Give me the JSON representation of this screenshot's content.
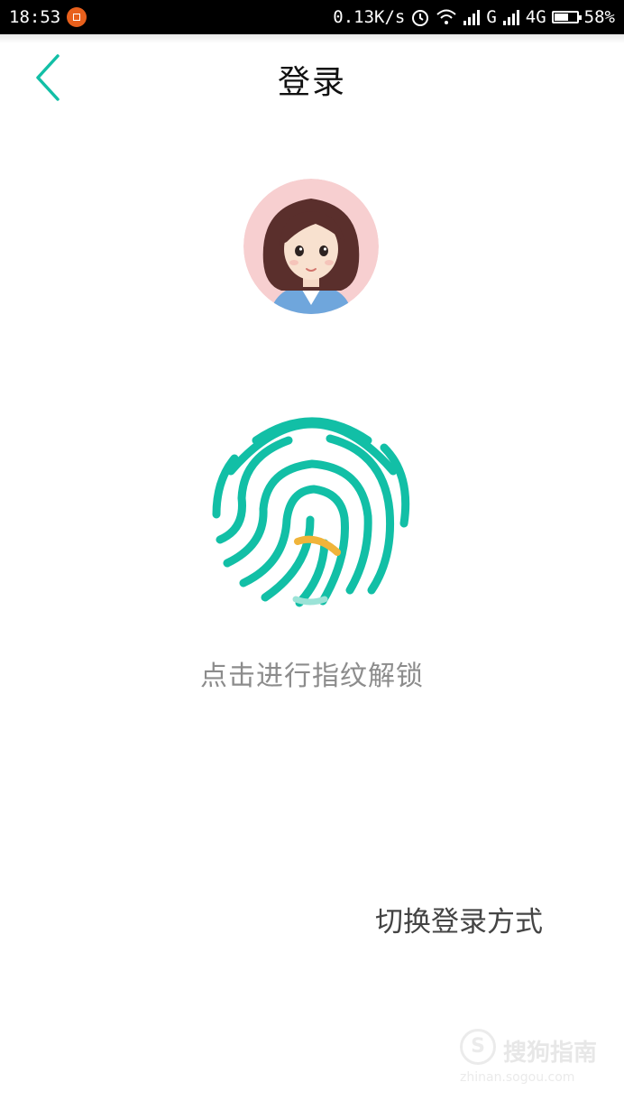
{
  "status_bar": {
    "time": "18:53",
    "network_speed": "0.13K/s",
    "signal_labels": "G",
    "network_type": "4G",
    "battery_level": "58%",
    "icons": [
      "alarm-icon",
      "wifi-icon",
      "signal-icon",
      "battery-icon"
    ]
  },
  "header": {
    "title": "登录",
    "back_icon": "chevron-left-icon"
  },
  "main": {
    "avatar": "avatar",
    "fingerprint_icon": "fingerprint-icon",
    "hint_text": "点击进行指纹解锁",
    "switch_label": "切换登录方式"
  },
  "watermark": {
    "logo_letter": "S",
    "text": "搜狗指南",
    "url": "zhinan.sogou.com"
  },
  "colors": {
    "accent": "#12bfa6",
    "scan": "#f0b43a",
    "avatar_bg": "#f7cfd0"
  }
}
